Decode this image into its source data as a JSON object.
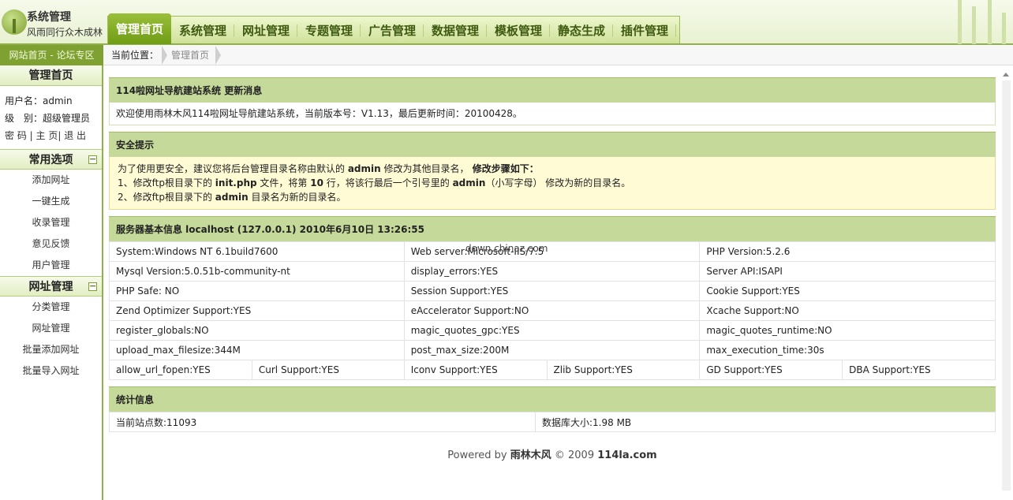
{
  "header": {
    "logo_title": "系统管理",
    "logo_slogan": "风雨同行众木成林",
    "nav": [
      "管理首页",
      "系统管理",
      "网址管理",
      "专题管理",
      "广告管理",
      "数据管理",
      "模板管理",
      "静态生成",
      "插件管理"
    ],
    "active_tab": "管理首页"
  },
  "subbar": {
    "site_link": "网站首页",
    "sep": " - ",
    "forum_link": "论坛专区",
    "location_label": "当前位置：",
    "crumb": "管理首页"
  },
  "sidebar": {
    "home_title": "管理首页",
    "username_label": "用户名：",
    "username": "admin",
    "level_label": "级　别：",
    "level": "超级管理员",
    "link_password": "密 码",
    "link_home": "主 页",
    "link_logout": "退 出",
    "group1_title": "常用选项",
    "group1_items": [
      "添加网址",
      "一键生成",
      "收录管理",
      "意见反馈",
      "用户管理"
    ],
    "group2_title": "网址管理",
    "group2_items": [
      "分类管理",
      "网址管理",
      "批量添加网址",
      "批量导入网址"
    ],
    "collapse_symbol": "−"
  },
  "update": {
    "title": "114啦网址导航建站系统  更新消息",
    "text": "欢迎使用雨林木风114啦网址导航建站系统，当前版本号：V1.13，最后更新时间：20100428。"
  },
  "security": {
    "title": "安全提示",
    "line1_a": "为了使用更安全，建议您将后台管理目录名称由默认的 ",
    "line1_b": "admin",
    "line1_c": "  修改为其他目录名，",
    "line1_d": " 修改步骤如下：",
    "line2_a": "1、修改ftp根目录下的 ",
    "line2_b": "init.php",
    "line2_c": " 文件，将第 ",
    "line2_d": "10",
    "line2_e": " 行，将该行最后一个引号里的 ",
    "line2_f": "admin",
    "line2_g": "（小写字母） 修改为新的目录名。",
    "line3_a": "2、修改ftp根目录下的 ",
    "line3_b": "admin",
    "line3_c": " 目录名为新的目录名。"
  },
  "server": {
    "title": "服务器基本信息  localhost (127.0.0.1)  2010年6月10日  13:26:55",
    "rows": [
      [
        "System:Windows NT 6.1build7600",
        "Web server:Microsoft-IIS/7.5",
        "PHP Version:5.2.6"
      ],
      [
        "Mysql Version:5.0.51b-community-nt",
        "display_errors:YES",
        "Server API:ISAPI"
      ],
      [
        "PHP Safe: NO",
        "Session Support:YES",
        "Cookie Support:YES"
      ],
      [
        "Zend Optimizer Support:YES",
        "eAccelerator Support:NO",
        "Xcache Support:NO"
      ],
      [
        "register_globals:NO",
        "magic_quotes_gpc:YES",
        "magic_quotes_runtime:NO"
      ],
      [
        "upload_max_filesize:344M",
        "post_max_size:200M",
        "max_execution_time:30s"
      ]
    ],
    "last_row": [
      "allow_url_fopen:YES",
      "Curl Support:YES",
      "Iconv Support:YES",
      "Zlib Support:YES",
      "GD Support:YES",
      "DBA Support:YES"
    ]
  },
  "stats": {
    "title": "统计信息",
    "sites": "当前站点数:11093",
    "db_size": "数据库大小:1.98 MB"
  },
  "watermark": "down.chinaz.com",
  "footer": {
    "powered": "Powered by ",
    "brand": "雨林木风",
    "copy": " © 2009 ",
    "site": "114la.com"
  }
}
